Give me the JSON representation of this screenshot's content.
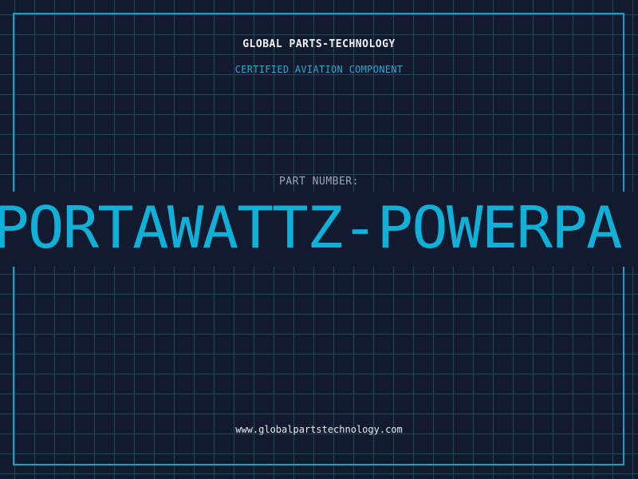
{
  "header": {
    "brand": "GLOBAL PARTS-TECHNOLOGY",
    "tagline": "CERTIFIED AVIATION COMPONENT"
  },
  "part": {
    "label": "PART NUMBER:",
    "number": "PORTAWATTZ-POWERPA"
  },
  "footer": {
    "website": "www.globalpartstechnology.com"
  },
  "colors": {
    "background": "#111a2e",
    "grid": "#1e4a5c",
    "frame": "#1b9ec4",
    "accent": "#10b0d8",
    "brand_text": "#f2f4f7",
    "label_text": "#9aa8bb"
  }
}
